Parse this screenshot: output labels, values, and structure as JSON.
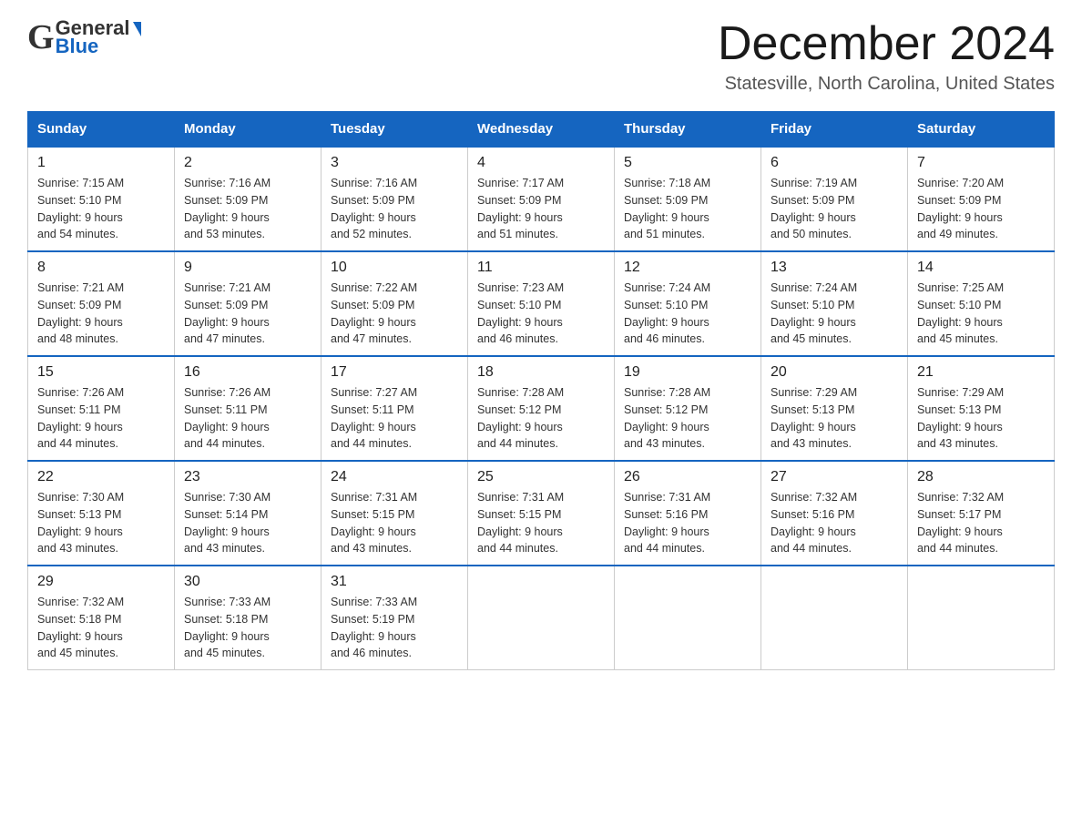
{
  "header": {
    "logo_general": "General",
    "logo_blue": "Blue",
    "month_title": "December 2024",
    "location": "Statesville, North Carolina, United States"
  },
  "days_of_week": [
    "Sunday",
    "Monday",
    "Tuesday",
    "Wednesday",
    "Thursday",
    "Friday",
    "Saturday"
  ],
  "weeks": [
    [
      {
        "day": "1",
        "sunrise": "7:15 AM",
        "sunset": "5:10 PM",
        "daylight": "9 hours and 54 minutes."
      },
      {
        "day": "2",
        "sunrise": "7:16 AM",
        "sunset": "5:09 PM",
        "daylight": "9 hours and 53 minutes."
      },
      {
        "day": "3",
        "sunrise": "7:16 AM",
        "sunset": "5:09 PM",
        "daylight": "9 hours and 52 minutes."
      },
      {
        "day": "4",
        "sunrise": "7:17 AM",
        "sunset": "5:09 PM",
        "daylight": "9 hours and 51 minutes."
      },
      {
        "day": "5",
        "sunrise": "7:18 AM",
        "sunset": "5:09 PM",
        "daylight": "9 hours and 51 minutes."
      },
      {
        "day": "6",
        "sunrise": "7:19 AM",
        "sunset": "5:09 PM",
        "daylight": "9 hours and 50 minutes."
      },
      {
        "day": "7",
        "sunrise": "7:20 AM",
        "sunset": "5:09 PM",
        "daylight": "9 hours and 49 minutes."
      }
    ],
    [
      {
        "day": "8",
        "sunrise": "7:21 AM",
        "sunset": "5:09 PM",
        "daylight": "9 hours and 48 minutes."
      },
      {
        "day": "9",
        "sunrise": "7:21 AM",
        "sunset": "5:09 PM",
        "daylight": "9 hours and 47 minutes."
      },
      {
        "day": "10",
        "sunrise": "7:22 AM",
        "sunset": "5:09 PM",
        "daylight": "9 hours and 47 minutes."
      },
      {
        "day": "11",
        "sunrise": "7:23 AM",
        "sunset": "5:10 PM",
        "daylight": "9 hours and 46 minutes."
      },
      {
        "day": "12",
        "sunrise": "7:24 AM",
        "sunset": "5:10 PM",
        "daylight": "9 hours and 46 minutes."
      },
      {
        "day": "13",
        "sunrise": "7:24 AM",
        "sunset": "5:10 PM",
        "daylight": "9 hours and 45 minutes."
      },
      {
        "day": "14",
        "sunrise": "7:25 AM",
        "sunset": "5:10 PM",
        "daylight": "9 hours and 45 minutes."
      }
    ],
    [
      {
        "day": "15",
        "sunrise": "7:26 AM",
        "sunset": "5:11 PM",
        "daylight": "9 hours and 44 minutes."
      },
      {
        "day": "16",
        "sunrise": "7:26 AM",
        "sunset": "5:11 PM",
        "daylight": "9 hours and 44 minutes."
      },
      {
        "day": "17",
        "sunrise": "7:27 AM",
        "sunset": "5:11 PM",
        "daylight": "9 hours and 44 minutes."
      },
      {
        "day": "18",
        "sunrise": "7:28 AM",
        "sunset": "5:12 PM",
        "daylight": "9 hours and 44 minutes."
      },
      {
        "day": "19",
        "sunrise": "7:28 AM",
        "sunset": "5:12 PM",
        "daylight": "9 hours and 43 minutes."
      },
      {
        "day": "20",
        "sunrise": "7:29 AM",
        "sunset": "5:13 PM",
        "daylight": "9 hours and 43 minutes."
      },
      {
        "day": "21",
        "sunrise": "7:29 AM",
        "sunset": "5:13 PM",
        "daylight": "9 hours and 43 minutes."
      }
    ],
    [
      {
        "day": "22",
        "sunrise": "7:30 AM",
        "sunset": "5:13 PM",
        "daylight": "9 hours and 43 minutes."
      },
      {
        "day": "23",
        "sunrise": "7:30 AM",
        "sunset": "5:14 PM",
        "daylight": "9 hours and 43 minutes."
      },
      {
        "day": "24",
        "sunrise": "7:31 AM",
        "sunset": "5:15 PM",
        "daylight": "9 hours and 43 minutes."
      },
      {
        "day": "25",
        "sunrise": "7:31 AM",
        "sunset": "5:15 PM",
        "daylight": "9 hours and 44 minutes."
      },
      {
        "day": "26",
        "sunrise": "7:31 AM",
        "sunset": "5:16 PM",
        "daylight": "9 hours and 44 minutes."
      },
      {
        "day": "27",
        "sunrise": "7:32 AM",
        "sunset": "5:16 PM",
        "daylight": "9 hours and 44 minutes."
      },
      {
        "day": "28",
        "sunrise": "7:32 AM",
        "sunset": "5:17 PM",
        "daylight": "9 hours and 44 minutes."
      }
    ],
    [
      {
        "day": "29",
        "sunrise": "7:32 AM",
        "sunset": "5:18 PM",
        "daylight": "9 hours and 45 minutes."
      },
      {
        "day": "30",
        "sunrise": "7:33 AM",
        "sunset": "5:18 PM",
        "daylight": "9 hours and 45 minutes."
      },
      {
        "day": "31",
        "sunrise": "7:33 AM",
        "sunset": "5:19 PM",
        "daylight": "9 hours and 46 minutes."
      },
      null,
      null,
      null,
      null
    ]
  ],
  "labels": {
    "sunrise": "Sunrise:",
    "sunset": "Sunset:",
    "daylight": "Daylight:"
  }
}
